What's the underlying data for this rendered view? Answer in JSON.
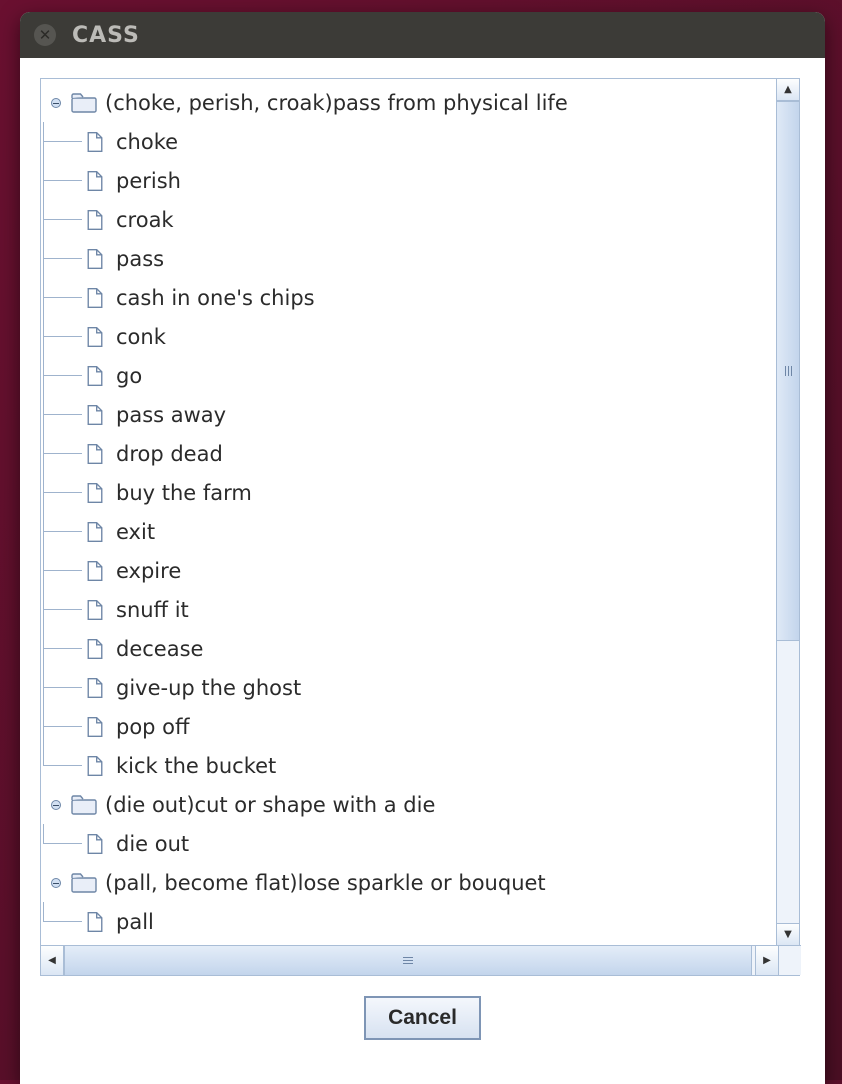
{
  "window": {
    "title": "CASS"
  },
  "buttons": {
    "cancel": "Cancel"
  },
  "tree": {
    "nodes": [
      {
        "label": "(choke, perish, croak)pass from physical life",
        "children": [
          {
            "label": "choke"
          },
          {
            "label": "perish"
          },
          {
            "label": "croak"
          },
          {
            "label": "pass"
          },
          {
            "label": "cash in one's chips"
          },
          {
            "label": "conk"
          },
          {
            "label": "go"
          },
          {
            "label": "pass away"
          },
          {
            "label": "drop dead"
          },
          {
            "label": "buy the farm"
          },
          {
            "label": "exit"
          },
          {
            "label": "expire"
          },
          {
            "label": "snuff it"
          },
          {
            "label": "decease"
          },
          {
            "label": "give-up the ghost"
          },
          {
            "label": "pop off"
          },
          {
            "label": "kick the bucket"
          }
        ]
      },
      {
        "label": "(die out)cut or shape with a die",
        "children": [
          {
            "label": "die out"
          }
        ]
      },
      {
        "label": "(pall, become flat)lose sparkle or bouquet",
        "children": [
          {
            "label": "pall"
          }
        ]
      }
    ]
  }
}
